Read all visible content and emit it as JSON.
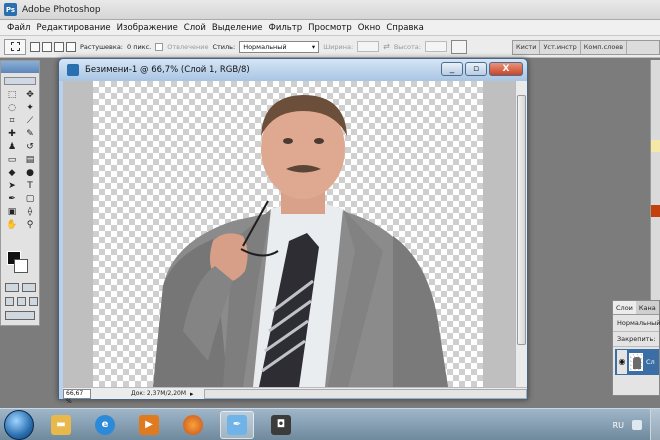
{
  "app": {
    "title": "Adobe Photoshop",
    "icon_label": "Ps"
  },
  "menu": [
    "Файл",
    "Редактирование",
    "Изображение",
    "Слой",
    "Выделение",
    "Фильтр",
    "Просмотр",
    "Окно",
    "Справка"
  ],
  "options": {
    "feather_label": "Растушевка:",
    "feather_value": "0 пикс.",
    "antialias_label": "Отвлечение",
    "style_label": "Стиль:",
    "style_value": "Нормальный",
    "width_label": "Ширина:",
    "height_label": "Высота:"
  },
  "palette_well": [
    "Кисти",
    "Уст.инстр",
    "Комп.слоев"
  ],
  "document": {
    "title": "Безимени-1 @ 66,7% (Слой 1, RGB/8)",
    "zoom": "66,67 %",
    "doc_info": "Док: 2,37M/2,20M"
  },
  "window_buttons": {
    "minimize": "_",
    "maximize": "▫",
    "close": "X"
  },
  "layers_panel": {
    "tabs": [
      "Слои",
      "Кана"
    ],
    "blend_mode": "Нормальный",
    "lock_label": "Закрепить:",
    "layer_name": "Сл"
  },
  "taskbar": {
    "apps": [
      "explorer",
      "internet-explorer",
      "media-player",
      "firefox",
      "photoshop-feather",
      "camera"
    ],
    "language": "RU"
  },
  "colors": {
    "accent": "#2a6fb0",
    "canvas_check": "#cfcfcf",
    "window_frame": "#b9d1ea",
    "close_red": "#c7452a"
  }
}
